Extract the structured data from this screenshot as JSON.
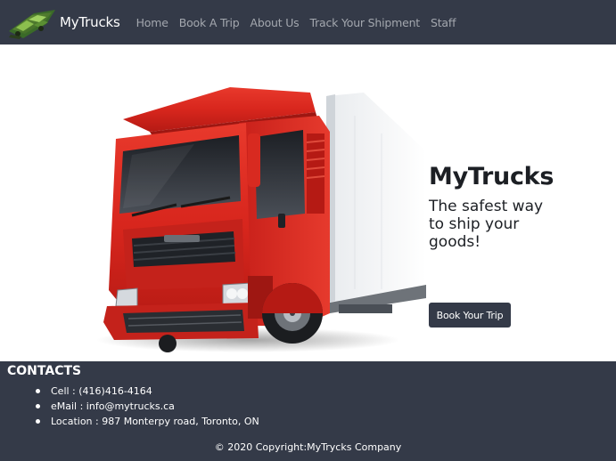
{
  "header": {
    "brand": "MyTrucks",
    "nav": [
      "Home",
      "Book A Trip",
      "About Us",
      "Track Your Shipment",
      "Staff"
    ]
  },
  "hero": {
    "title": "MyTrucks",
    "subtitle": "The safest way to ship your goods!",
    "button": "Book Your Trip"
  },
  "footer": {
    "title": "CONTACTS",
    "contacts": [
      "Cell : (416)416-4164",
      "eMail : info@mytrucks.ca",
      "Location : 987 Monterpy road, Toronto, ON"
    ],
    "copyright": "© 2020 Copyright:MyTrycks Company"
  },
  "colors": {
    "nav_bg": "#343a48",
    "nav_link": "#a3a7ae",
    "truck_red": "#d8261d"
  },
  "icons": {
    "logo": "truck-logo-icon",
    "hero_image": "red-truck-illustration"
  }
}
